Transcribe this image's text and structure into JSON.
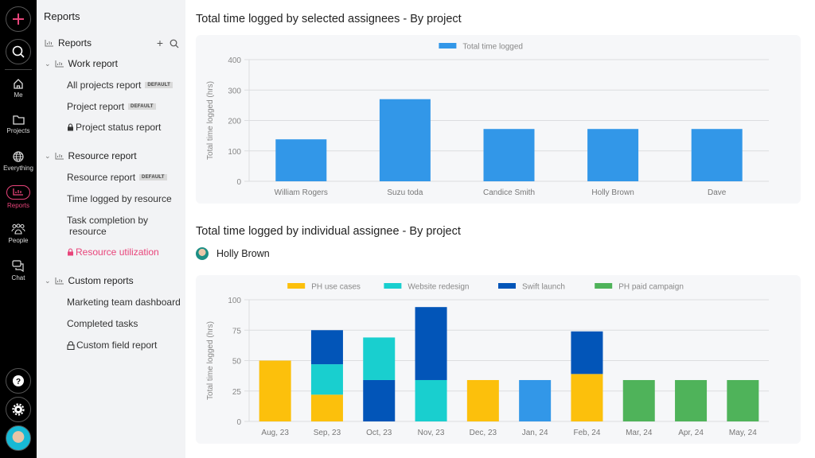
{
  "rail": {
    "add_icon": "plus-icon",
    "search_icon": "search-icon",
    "items": [
      {
        "label": "Me",
        "icon": "home-icon"
      },
      {
        "label": "Projects",
        "icon": "folder-icon"
      },
      {
        "label": "Everything",
        "icon": "globe-icon"
      },
      {
        "label": "Reports",
        "icon": "bar-chart-icon",
        "active": true
      },
      {
        "label": "People",
        "icon": "people-icon"
      },
      {
        "label": "Chat",
        "icon": "chat-icon"
      }
    ],
    "bottom": [
      "help-icon",
      "settings-icon",
      "avatar"
    ]
  },
  "sidebar": {
    "title": "Reports",
    "header": "Reports",
    "groups": [
      {
        "label": "Work report",
        "items": [
          {
            "label": "All projects report",
            "badge": "DEFAULT"
          },
          {
            "label": "Project report",
            "badge": "DEFAULT"
          },
          {
            "label": "Project status report",
            "locked": true
          }
        ]
      },
      {
        "label": "Resource report",
        "items": [
          {
            "label": "Resource report",
            "badge": "DEFAULT"
          },
          {
            "label": "Time logged by resource"
          },
          {
            "label": "Task completion by",
            "label2": "resource"
          },
          {
            "label": "Resource utilization",
            "locked": true,
            "active": true
          }
        ]
      },
      {
        "label": "Custom reports",
        "items": [
          {
            "label": "Marketing team dashboard"
          },
          {
            "label": "Completed tasks"
          },
          {
            "label": "Custom field report",
            "locked": true
          }
        ]
      }
    ]
  },
  "main": {
    "chart1_title": "Total time logged by selected assignees - By project",
    "chart2_title": "Total time logged by individual assignee - By project",
    "selected_person": "Holly Brown"
  },
  "colors": {
    "accent": "#e8447a",
    "blue": "#3297e8",
    "yellow": "#fcc00c",
    "teal": "#19cfcf",
    "darkblue": "#0255b8",
    "green": "#4fb35a"
  },
  "chart_data": [
    {
      "type": "bar",
      "title": "Total time logged by selected assignees - By project",
      "categories": [
        "William Rogers",
        "Suzu toda",
        "Candice Smith",
        "Holly Brown",
        "Dave"
      ],
      "series": [
        {
          "name": "Total time logged",
          "color": "#3297e8",
          "values": [
            138,
            270,
            172,
            172,
            172
          ]
        }
      ],
      "xlabel": "",
      "ylabel": "Total time logged (hrs)",
      "ylim": [
        0,
        400
      ],
      "yticks": [
        0,
        100,
        200,
        300,
        400
      ],
      "grid": true,
      "legend": "top-center"
    },
    {
      "type": "bar",
      "stacked": true,
      "title": "Total time logged by individual assignee - By project",
      "categories": [
        "Aug, 23",
        "Sep, 23",
        "Oct, 23",
        "Nov, 23",
        "Dec, 23",
        "Jan, 24",
        "Feb, 24",
        "Mar, 24",
        "Apr, 24",
        "May, 24"
      ],
      "series": [
        {
          "name": "PH use cases",
          "color": "#fcc00c",
          "values": [
            50,
            22,
            0,
            0,
            34,
            0,
            39,
            0,
            0,
            0
          ]
        },
        {
          "name": "Website redesign",
          "color": "#19cfcf",
          "values": [
            0,
            25,
            0,
            34,
            0,
            0,
            0,
            0,
            0,
            0
          ]
        },
        {
          "name": "Swift launch",
          "color": "#0255b8",
          "values": [
            0,
            28,
            34,
            60,
            0,
            0,
            35,
            0,
            0,
            0
          ]
        },
        {
          "name": "Website redesign (stacked above)",
          "color": "#19cfcf",
          "legend": false,
          "values": [
            0,
            0,
            35,
            0,
            0,
            0,
            0,
            0,
            0,
            0
          ]
        },
        {
          "name": "Other",
          "color": "#3297e8",
          "legend": false,
          "values": [
            0,
            0,
            0,
            0,
            0,
            34,
            0,
            0,
            0,
            0
          ]
        },
        {
          "name": "PH paid campaign",
          "color": "#4fb35a",
          "values": [
            0,
            0,
            0,
            0,
            0,
            0,
            0,
            34,
            34,
            34
          ]
        }
      ],
      "legend_entries": [
        "PH use cases",
        "Website redesign",
        "Swift launch",
        "PH paid campaign"
      ],
      "xlabel": "",
      "ylabel": "Total time logged (hrs)",
      "ylim": [
        0,
        100
      ],
      "yticks": [
        0,
        25,
        50,
        75,
        100
      ],
      "grid": true,
      "legend": "top-center"
    }
  ]
}
